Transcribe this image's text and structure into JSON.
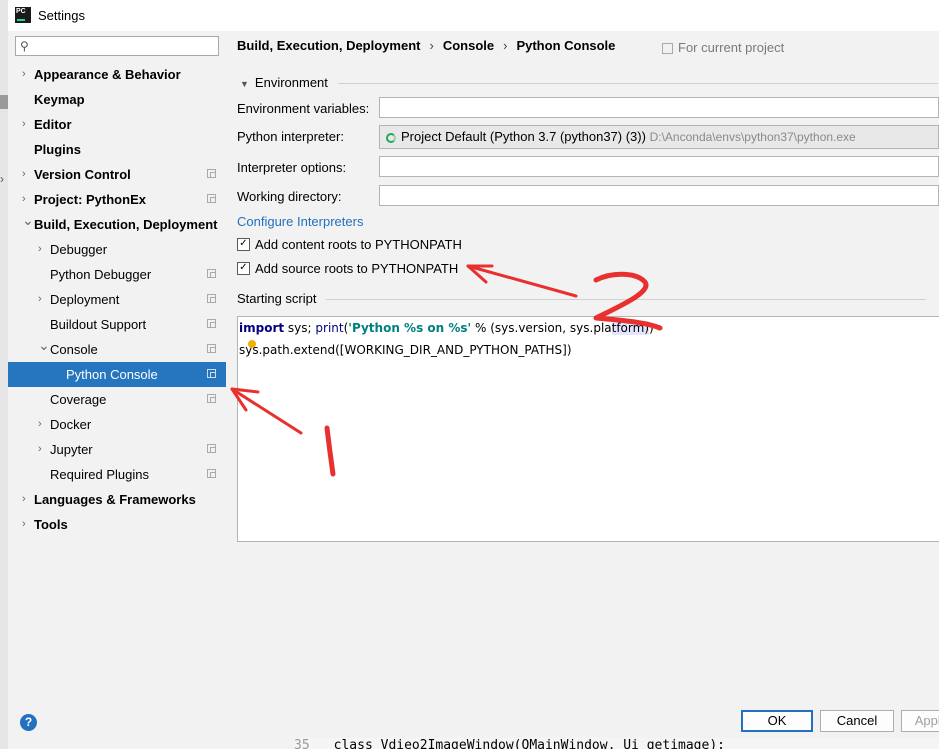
{
  "window": {
    "title": "Settings"
  },
  "sidebar": {
    "search_placeholder": "",
    "items": [
      {
        "label": "Appearance & Behavior",
        "bold": true,
        "chevron": "right",
        "indent": 0,
        "copy": false
      },
      {
        "label": "Keymap",
        "bold": true,
        "chevron": "",
        "indent": 0,
        "copy": false
      },
      {
        "label": "Editor",
        "bold": true,
        "chevron": "right",
        "indent": 0,
        "copy": false
      },
      {
        "label": "Plugins",
        "bold": true,
        "chevron": "",
        "indent": 0,
        "copy": false
      },
      {
        "label": "Version Control",
        "bold": true,
        "chevron": "right",
        "indent": 0,
        "copy": true
      },
      {
        "label": "Project: PythonEx",
        "bold": true,
        "chevron": "right",
        "indent": 0,
        "copy": true
      },
      {
        "label": "Build, Execution, Deployment",
        "bold": true,
        "chevron": "down",
        "indent": 0,
        "copy": false
      },
      {
        "label": "Debugger",
        "bold": false,
        "chevron": "right",
        "indent": 1,
        "copy": false
      },
      {
        "label": "Python Debugger",
        "bold": false,
        "chevron": "",
        "indent": 1,
        "copy": true
      },
      {
        "label": "Deployment",
        "bold": false,
        "chevron": "right",
        "indent": 1,
        "copy": true
      },
      {
        "label": "Buildout Support",
        "bold": false,
        "chevron": "",
        "indent": 1,
        "copy": true
      },
      {
        "label": "Console",
        "bold": false,
        "chevron": "down",
        "indent": 1,
        "copy": true
      },
      {
        "label": "Python Console",
        "bold": false,
        "chevron": "",
        "indent": 2,
        "copy": true,
        "selected": true
      },
      {
        "label": "Coverage",
        "bold": false,
        "chevron": "",
        "indent": 1,
        "copy": true
      },
      {
        "label": "Docker",
        "bold": false,
        "chevron": "right",
        "indent": 1,
        "copy": false
      },
      {
        "label": "Jupyter",
        "bold": false,
        "chevron": "right",
        "indent": 1,
        "copy": true
      },
      {
        "label": "Required Plugins",
        "bold": false,
        "chevron": "",
        "indent": 1,
        "copy": true
      },
      {
        "label": "Languages & Frameworks",
        "bold": true,
        "chevron": "right",
        "indent": 0,
        "copy": false
      },
      {
        "label": "Tools",
        "bold": true,
        "chevron": "right",
        "indent": 0,
        "copy": false
      }
    ]
  },
  "breadcrumb": {
    "part1": "Build, Execution, Deployment",
    "sep": "›",
    "part2": "Console",
    "part3": "Python Console"
  },
  "scope_note": "For current project",
  "environment": {
    "section_label": "Environment",
    "env_vars_label": "Environment variables:",
    "env_vars_value": "",
    "interpreter_label": "Python interpreter:",
    "interpreter_value": "Project Default (Python 3.7 (python37) (3))",
    "interpreter_path": "D:\\Anconda\\envs\\python37\\python.exe",
    "options_label": "Interpreter options:",
    "options_value": "",
    "workdir_label": "Working directory:",
    "workdir_value": "",
    "configure_link": "Configure Interpreters",
    "content_roots_label": "Add content roots to PYTHONPATH",
    "content_roots_checked": true,
    "source_roots_label": "Add source roots to PYTHONPATH",
    "source_roots_checked": true
  },
  "starting_script": {
    "label": "Starting script",
    "line1": {
      "kw": "import",
      "t1": " sys; ",
      "fn": "print",
      "t2": "(",
      "str": "'Python %s on %s'",
      "t3": " % (sys.version, sys.pla",
      "hl": "tform",
      "t4": ")",
      "t5": ")"
    },
    "line2": "sys.path.extend([WORKING_DIR_AND_PYTHON_PATHS])"
  },
  "footer": {
    "help": "?",
    "ok": "OK",
    "cancel": "Cancel",
    "apply": "Apply"
  },
  "background_code": {
    "line_number": "35",
    "text": "class Vdieo2ImageWindow(QMainWindow, Ui_getimage):"
  },
  "annotations": {
    "mark1": "1",
    "mark2": "2",
    "color": "#e8312f"
  },
  "colors": {
    "selection": "#2675bf",
    "link": "#2470c0",
    "keyword": "#000080",
    "string": "#008080",
    "ok_border": "#2470c0"
  }
}
